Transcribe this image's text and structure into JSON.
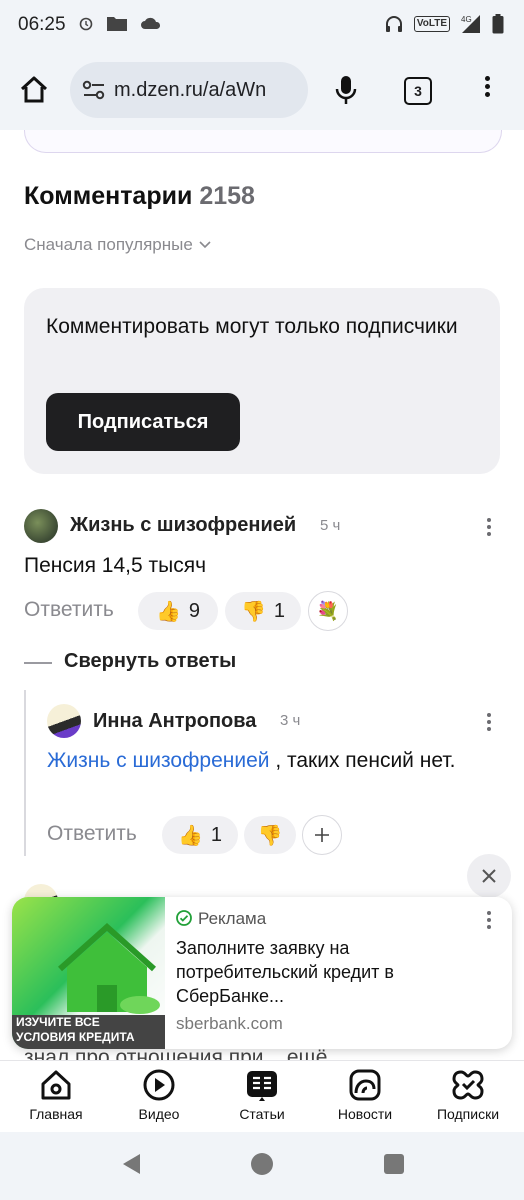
{
  "status_bar": {
    "time": "06:25",
    "network_label": "VoLTE",
    "network_gen": "4G"
  },
  "browser": {
    "url": "m.dzen.ru/a/aWn",
    "tabs_count": "3"
  },
  "comments": {
    "title": "Комментарии",
    "count": "2158",
    "sort_label": "Сначала популярные"
  },
  "subscribe_card": {
    "text": "Комментировать могут только подписчики",
    "button_label": "Подписаться"
  },
  "comment1": {
    "author": "Жизнь с шизофренией",
    "time": "5 ч",
    "text": "Пенсия 14,5 тысяч",
    "reply_label": "Ответить",
    "likes": "9",
    "dislikes": "1"
  },
  "collapse_replies_label": "Свернуть ответы",
  "reply1": {
    "author": "Инна Антропова",
    "time": "3 ч",
    "mention": "Жизнь с шизофренией",
    "text": " , таких пенсий нет.",
    "reply_label": "Ответить",
    "likes": "1"
  },
  "ad": {
    "label": "Реклама",
    "title": "Заполните заявку на потребительский кредит в СберБанке...",
    "domain": "sberbank.com",
    "image_text": "ИЗУЧИТЕ ВСЕ УСЛОВИЯ КРЕДИТА"
  },
  "peek_text": "знал про отношения при... ещё",
  "bottom_nav": {
    "items": [
      {
        "label": "Главная",
        "icon": "home-icon"
      },
      {
        "label": "Видео",
        "icon": "play-icon"
      },
      {
        "label": "Статьи",
        "icon": "articles-icon"
      },
      {
        "label": "Новости",
        "icon": "news-icon"
      },
      {
        "label": "Подписки",
        "icon": "subscriptions-icon"
      }
    ]
  },
  "colors": {
    "accent_link": "#2a6bd6",
    "button_dark": "#1f1f21",
    "card_bg": "#f0f0f3"
  }
}
